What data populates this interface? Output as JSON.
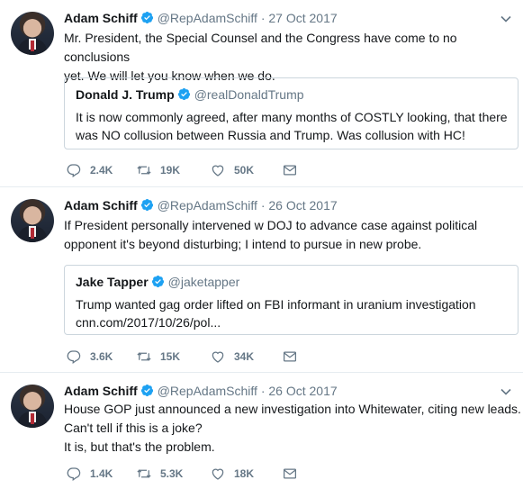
{
  "tweets": [
    {
      "author": "Adam Schiff",
      "handle": "@RepAdamSchiff",
      "separator": "·",
      "date": "27 Oct 2017",
      "text_lines": [
        "Mr. President, the Special Counsel and the Congress have come to no conclusions",
        "yet. We will let you know when we do."
      ],
      "quote": {
        "author": "Donald J. Trump",
        "handle": "@realDonaldTrump",
        "text_lines": [
          "It is now commonly agreed, after many months of COSTLY looking, that there",
          "was NO collusion between Russia and Trump. Was collusion with HC!"
        ]
      },
      "replies": "2.4K",
      "retweets": "19K",
      "likes": "50K"
    },
    {
      "author": "Adam Schiff",
      "handle": "@RepAdamSchiff",
      "separator": "·",
      "date": "26 Oct 2017",
      "text_lines": [
        "If President personally intervened w DOJ to advance case against political",
        "opponent it's beyond disturbing; I intend to pursue in new probe."
      ],
      "quote": {
        "author": "Jake Tapper",
        "handle": "@jaketapper",
        "text_lines": [
          "Trump wanted gag order lifted on FBI informant in uranium investigation",
          "cnn.com/2017/10/26/pol..."
        ]
      },
      "replies": "3.6K",
      "retweets": "15K",
      "likes": "34K"
    },
    {
      "author": "Adam Schiff",
      "handle": "@RepAdamSchiff",
      "separator": "·",
      "date": "26 Oct 2017",
      "text_lines": [
        "House GOP just announced a new investigation into Whitewater, citing new leads.",
        "Can't tell if this is a joke?",
        "It is, but that's the problem."
      ],
      "replies": "1.4K",
      "retweets": "5.3K",
      "likes": "18K"
    }
  ],
  "colors": {
    "verified": "#1da1f2",
    "muted": "#657786",
    "border": "#e6ecf0"
  },
  "icons": [
    "reply-icon",
    "retweet-icon",
    "like-icon",
    "message-icon",
    "verified-icon",
    "chevron-down-icon"
  ]
}
